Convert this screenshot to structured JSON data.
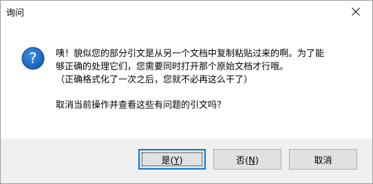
{
  "window": {
    "title": "询问"
  },
  "message": {
    "line1": "咦！貌似您的部分引文是从另一个文档中复制粘贴过来的啊。为了能",
    "line2": "够正确的处理它们，您需要同时打开那个原始文档才行哦。",
    "line3": "（正确格式化了一次之后，您就不必再这么干了）",
    "question": "取消当前操作并查看这些有问题的引文吗？"
  },
  "buttons": {
    "yes": {
      "label": "是",
      "mnemonic": "(",
      "key": "Y",
      "close": ")"
    },
    "no": {
      "label": "否",
      "mnemonic": "(",
      "key": "N",
      "close": ")"
    },
    "cancel": {
      "label": "取消"
    }
  },
  "icons": {
    "question": "question-icon",
    "close": "close-icon"
  },
  "colors": {
    "accent": "#0078d7",
    "icon_fill": "#1c6fc4"
  }
}
